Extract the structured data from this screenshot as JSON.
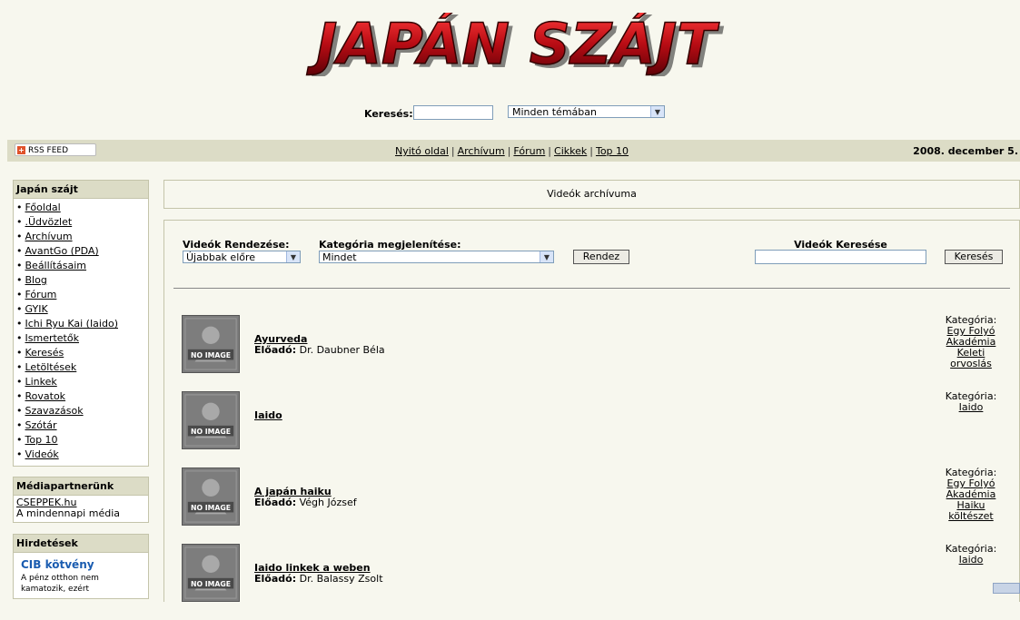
{
  "logo_text": "JAPÁN SZÁJT",
  "search": {
    "label": "Keresés:",
    "value": "",
    "topic_selected": "Minden témában"
  },
  "rss": {
    "label": "RSS FEED"
  },
  "nav": {
    "links": [
      "Nyitó oldal",
      "Archívum",
      "Fórum",
      "Cikkek",
      "Top 10"
    ],
    "separator": "|",
    "date": "2008. december 5."
  },
  "sidebar": {
    "main": {
      "title": "Japán szájt",
      "items": [
        "Főoldal",
        ".Üdvözlet",
        "Archívum",
        "AvantGo (PDA)",
        "Beállításaim",
        "Blog",
        "Fórum",
        "GYIK",
        "Ichi Ryu Kai (Iaido)",
        "Ismertetők",
        "Keresés",
        "Letöltések",
        "Linkek",
        "Rovatok",
        "Szavazások",
        "Szótár",
        "Top 10",
        "Videók"
      ]
    },
    "partner": {
      "title": "Médiapartnerünk",
      "link": "CSEPPEK.hu",
      "text": "A mindennapi média"
    },
    "ads": {
      "title": "Hirdetések",
      "ad_title": "CIB kötvény",
      "ad_text": "A pénz otthon nem kamatozik, ezért"
    }
  },
  "main": {
    "title": "Videók archívuma",
    "sort_label": "Videók Rendezése:",
    "sort_value": "Újabbak előre",
    "category_label": "Kategória megjelenítése:",
    "category_value": "Mindet",
    "sort_button": "Rendez",
    "search_label": "Videók Keresése",
    "search_value": "",
    "search_button": "Keresés",
    "thumb_text": "NO IMAGE",
    "category_prefix": "Kategória:",
    "performer_prefix": "Előadó:",
    "videos": [
      {
        "title": "Ayurveda",
        "performer": "Dr. Daubner Béla",
        "categories": [
          "Egy Folyó Akadémia",
          "Keleti orvoslás"
        ]
      },
      {
        "title": "Iaido",
        "performer": "",
        "categories": [
          "Iaido"
        ]
      },
      {
        "title": "A japán haiku",
        "performer": "Végh József",
        "categories": [
          "Egy Folyó Akadémia",
          "Haiku költészet"
        ]
      },
      {
        "title": "Iaido linkek a weben",
        "performer": "Dr. Balassy Zsolt",
        "categories": [
          "Iaido"
        ]
      }
    ]
  },
  "colors": {
    "background": "#f7f7ee",
    "bar": "#dcdcc6",
    "logo_red": "#c0141c"
  }
}
